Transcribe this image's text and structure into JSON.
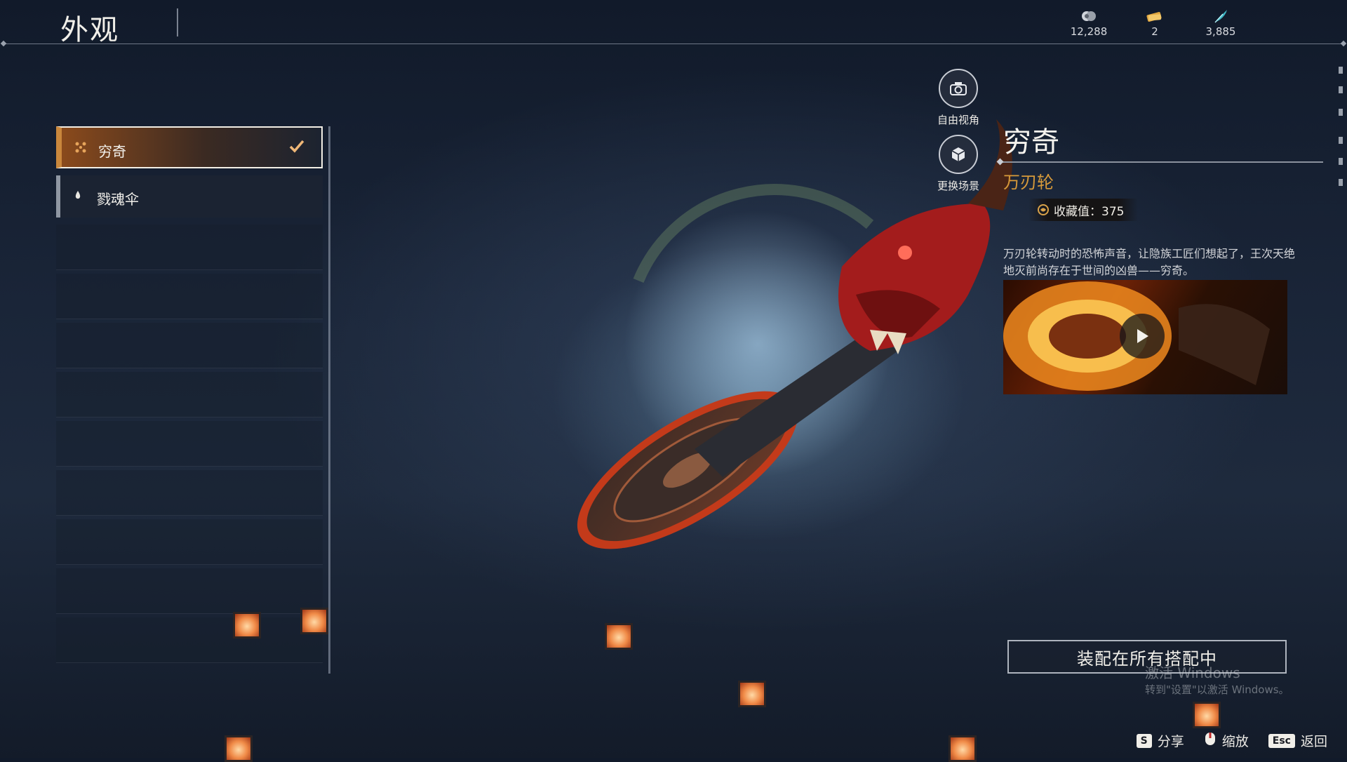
{
  "header": {
    "title": "外观"
  },
  "currencies": [
    {
      "icon": "coin-icon",
      "value": "12,288"
    },
    {
      "icon": "ticket-icon",
      "value": "2"
    },
    {
      "icon": "feather-icon",
      "value": "3,885"
    }
  ],
  "list": {
    "items": [
      {
        "label": "穷奇",
        "icon": "weapon-mark-icon",
        "selected": true
      },
      {
        "label": "戮魂伞",
        "icon": "drop-icon",
        "selected": false
      }
    ]
  },
  "camera_tools": [
    {
      "label": "自由视角",
      "icon": "camera-icon"
    },
    {
      "label": "更换场景",
      "icon": "scene-cube-icon"
    }
  ],
  "item": {
    "name": "穷奇",
    "type": "万刃轮",
    "collect_label": "收藏值",
    "collect_value": "375",
    "collect_text": "收藏值：375",
    "description": "万刃轮转动时的恐怖声音，让隐族工匠们想起了，王次天绝地灭前尚存在于世间的凶兽——穷奇。"
  },
  "equip_button": "装配在所有搭配中",
  "watermark": {
    "line1": "激活 Windows",
    "line2": "转到\"设置\"以激活 Windows。"
  },
  "hints": [
    {
      "key": "S",
      "label": "分享"
    },
    {
      "key": "",
      "label": "缩放",
      "icon": "mouse-icon"
    },
    {
      "key": "Esc",
      "label": "返回"
    }
  ],
  "colors": {
    "accent": "#c9873c",
    "type_text": "#d79a3a",
    "background": "#1a2538"
  }
}
